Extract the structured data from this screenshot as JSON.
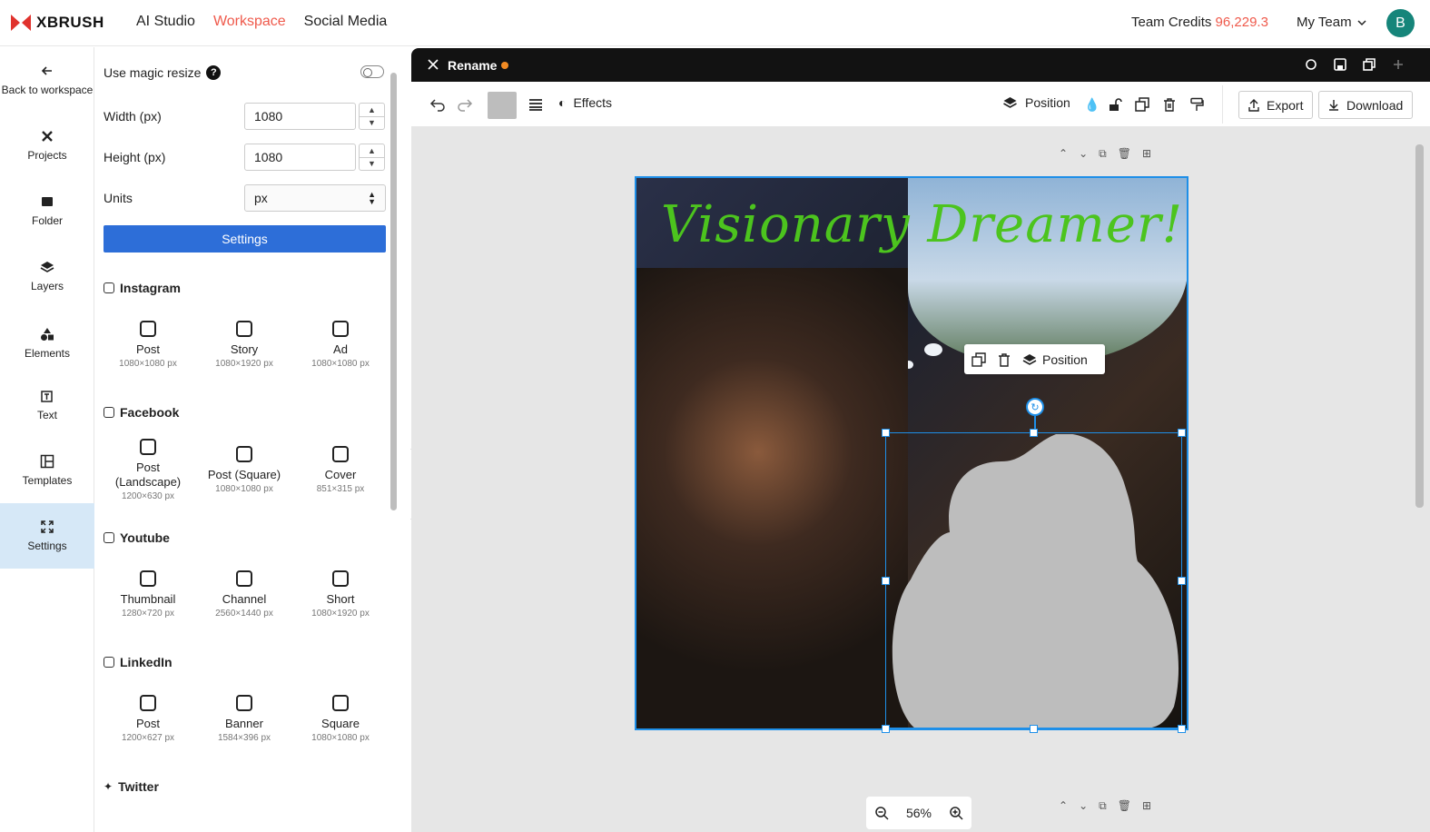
{
  "app": {
    "logo_text": "XBRUSH",
    "brand_color": "#e0322d",
    "accent_color": "#ef5a4c"
  },
  "nav": {
    "items": [
      "AI Studio",
      "Workspace",
      "Social Media"
    ],
    "active": "Workspace"
  },
  "header": {
    "credits_label": "Team Credits",
    "credits_value": "96,229.3",
    "team_label": "My Team",
    "avatar_letter": "B"
  },
  "sidebar": {
    "items": [
      {
        "label": "Back to workspace",
        "icon": "arrow-left-icon"
      },
      {
        "label": "Projects",
        "icon": "projects-icon"
      },
      {
        "label": "Folder",
        "icon": "folder-icon"
      },
      {
        "label": "Layers",
        "icon": "layers-icon"
      },
      {
        "label": "Elements",
        "icon": "shapes-icon"
      },
      {
        "label": "Text",
        "icon": "text-icon"
      },
      {
        "label": "Templates",
        "icon": "templates-icon"
      },
      {
        "label": "Settings",
        "icon": "resize-icon"
      }
    ],
    "active": "Settings"
  },
  "panel": {
    "magic_resize_label": "Use magic resize",
    "magic_resize_on": false,
    "width_label": "Width (px)",
    "width_value": "1080",
    "height_label": "Height (px)",
    "height_value": "1080",
    "units_label": "Units",
    "units_value": "px",
    "settings_button": "Settings",
    "sections": [
      {
        "title": "Instagram",
        "presets": [
          {
            "name": "Post",
            "size": "1080×1080 px"
          },
          {
            "name": "Story",
            "size": "1080×1920 px"
          },
          {
            "name": "Ad",
            "size": "1080×1080 px"
          }
        ]
      },
      {
        "title": "Facebook",
        "presets": [
          {
            "name": "Post (Landscape)",
            "size": "1200×630 px"
          },
          {
            "name": "Post (Square)",
            "size": "1080×1080 px"
          },
          {
            "name": "Cover",
            "size": "851×315 px"
          }
        ]
      },
      {
        "title": "Youtube",
        "presets": [
          {
            "name": "Thumbnail",
            "size": "1280×720 px"
          },
          {
            "name": "Channel",
            "size": "2560×1440 px"
          },
          {
            "name": "Short",
            "size": "1080×1920 px"
          }
        ]
      },
      {
        "title": "LinkedIn",
        "presets": [
          {
            "name": "Post",
            "size": "1200×627 px"
          },
          {
            "name": "Banner",
            "size": "1584×396 px"
          },
          {
            "name": "Square",
            "size": "1080×1080 px"
          }
        ]
      },
      {
        "title": "Twitter",
        "presets": []
      }
    ]
  },
  "editor": {
    "doc_title": "Rename",
    "unsaved_dot_color": "#f28b23",
    "toolbar": {
      "effects_label": "Effects",
      "position_label": "Position",
      "export_label": "Export",
      "download_label": "Download",
      "fill_color": "#bdbdbd"
    },
    "floating_toolbar": {
      "position_label": "Position"
    },
    "artboard_title": "Visionary Dreamer!",
    "zoom_value": "56%",
    "selection_color": "#1e8fe8",
    "shape_fill": "#bdbdbd"
  }
}
